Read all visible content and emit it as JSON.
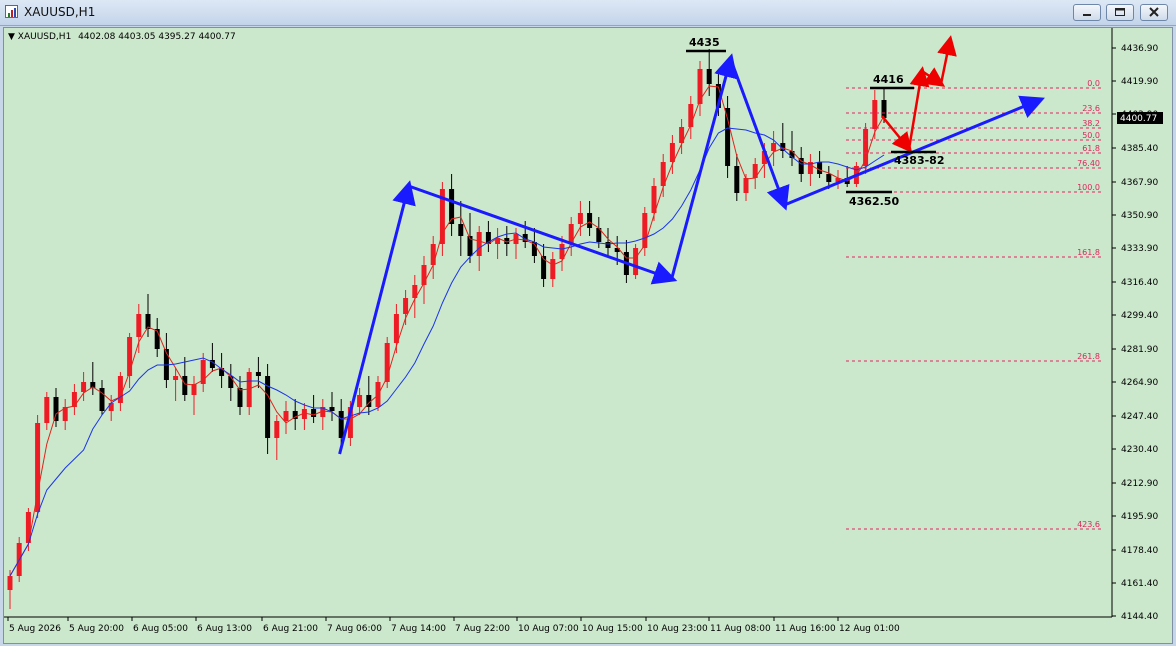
{
  "window": {
    "title": "XAUUSD,H1",
    "icon": "chart-window-icon"
  },
  "controls": {
    "minimize_icon": "minimize-icon",
    "restore_icon": "restore-icon",
    "close_icon": "close-icon"
  },
  "info": {
    "symbol": "XAUUSD,H1",
    "open": "4402.08",
    "high": "4403.05",
    "low": "4395.27",
    "close": "4400.77"
  },
  "colors": {
    "background": "#cce8cc",
    "bull": "#ee1b24",
    "bear": "#000000",
    "ma_fast": "#e0241b",
    "ma_slow": "#1a35e8",
    "pattern_blue": "#1a1aff",
    "projection_red": "#ee0000",
    "fib": "#e0245c",
    "price_marker_bg": "#000000"
  },
  "chart_data": {
    "type": "candlestick",
    "symbol": "XAUUSD",
    "timeframe": "H1",
    "ylim": [
      4144.0,
      4445.0
    ],
    "y_ticks": [
      "4436.90",
      "4419.90",
      "4402.90",
      "4385.40",
      "4367.90",
      "4350.90",
      "4333.90",
      "4316.40",
      "4299.40",
      "4281.90",
      "4264.90",
      "4247.40",
      "4230.40",
      "4212.90",
      "4195.90",
      "4178.40",
      "4161.40",
      "4144.40"
    ],
    "current_price": "4400.77",
    "x_ticks": [
      "5 Aug 2026",
      "5 Aug 20:00",
      "6 Aug 05:00",
      "6 Aug 13:00",
      "6 Aug 21:00",
      "7 Aug 06:00",
      "7 Aug 14:00",
      "7 Aug 22:00",
      "10 Aug 07:00",
      "10 Aug 15:00",
      "10 Aug 23:00",
      "11 Aug 08:00",
      "11 Aug 16:00",
      "12 Aug 01:00"
    ],
    "candles": [
      [
        4158,
        4168,
        4148,
        4165
      ],
      [
        4165,
        4185,
        4162,
        4182
      ],
      [
        4182,
        4200,
        4178,
        4198
      ],
      [
        4198,
        4248,
        4195,
        4244
      ],
      [
        4244,
        4260,
        4240,
        4257
      ],
      [
        4257,
        4262,
        4242,
        4245
      ],
      [
        4245,
        4256,
        4240,
        4252
      ],
      [
        4252,
        4264,
        4248,
        4260
      ],
      [
        4260,
        4270,
        4255,
        4265
      ],
      [
        4265,
        4275,
        4258,
        4262
      ],
      [
        4262,
        4266,
        4248,
        4250
      ],
      [
        4250,
        4258,
        4245,
        4254
      ],
      [
        4254,
        4270,
        4250,
        4268
      ],
      [
        4268,
        4290,
        4262,
        4288
      ],
      [
        4288,
        4305,
        4280,
        4300
      ],
      [
        4300,
        4310,
        4288,
        4292
      ],
      [
        4292,
        4298,
        4278,
        4282
      ],
      [
        4282,
        4290,
        4262,
        4266
      ],
      [
        4266,
        4272,
        4255,
        4268
      ],
      [
        4268,
        4278,
        4255,
        4258
      ],
      [
        4258,
        4268,
        4248,
        4264
      ],
      [
        4264,
        4280,
        4260,
        4276
      ],
      [
        4276,
        4285,
        4270,
        4272
      ],
      [
        4272,
        4280,
        4262,
        4268
      ],
      [
        4268,
        4274,
        4255,
        4262
      ],
      [
        4262,
        4268,
        4248,
        4252
      ],
      [
        4252,
        4272,
        4248,
        4270
      ],
      [
        4270,
        4278,
        4262,
        4268
      ],
      [
        4268,
        4274,
        4228,
        4236
      ],
      [
        4236,
        4248,
        4225,
        4245
      ],
      [
        4245,
        4255,
        4238,
        4250
      ],
      [
        4250,
        4256,
        4240,
        4246
      ],
      [
        4246,
        4254,
        4240,
        4251
      ],
      [
        4251,
        4258,
        4244,
        4247
      ],
      [
        4247,
        4256,
        4240,
        4252
      ],
      [
        4252,
        4260,
        4245,
        4250
      ],
      [
        4250,
        4256,
        4230,
        4236
      ],
      [
        4236,
        4255,
        4232,
        4252
      ],
      [
        4252,
        4262,
        4248,
        4258
      ],
      [
        4258,
        4268,
        4248,
        4252
      ],
      [
        4252,
        4268,
        4250,
        4265
      ],
      [
        4265,
        4288,
        4262,
        4285
      ],
      [
        4285,
        4305,
        4280,
        4300
      ],
      [
        4300,
        4312,
        4294,
        4308
      ],
      [
        4308,
        4320,
        4298,
        4315
      ],
      [
        4315,
        4330,
        4305,
        4325
      ],
      [
        4325,
        4340,
        4318,
        4336
      ],
      [
        4336,
        4368,
        4330,
        4364
      ],
      [
        4364,
        4372,
        4340,
        4346
      ],
      [
        4346,
        4358,
        4330,
        4340
      ],
      [
        4340,
        4352,
        4326,
        4330
      ],
      [
        4330,
        4345,
        4322,
        4342
      ],
      [
        4342,
        4348,
        4332,
        4336
      ],
      [
        4336,
        4344,
        4328,
        4339
      ],
      [
        4339,
        4345,
        4330,
        4336
      ],
      [
        4336,
        4344,
        4328,
        4341
      ],
      [
        4341,
        4348,
        4334,
        4337
      ],
      [
        4337,
        4344,
        4326,
        4330
      ],
      [
        4330,
        4336,
        4314,
        4318
      ],
      [
        4318,
        4332,
        4314,
        4328
      ],
      [
        4328,
        4340,
        4322,
        4336
      ],
      [
        4336,
        4350,
        4330,
        4346
      ],
      [
        4346,
        4358,
        4340,
        4352
      ],
      [
        4352,
        4358,
        4340,
        4344
      ],
      [
        4344,
        4350,
        4334,
        4337
      ],
      [
        4337,
        4344,
        4330,
        4334
      ],
      [
        4334,
        4340,
        4325,
        4332
      ],
      [
        4332,
        4338,
        4316,
        4320
      ],
      [
        4320,
        4336,
        4318,
        4334
      ],
      [
        4334,
        4355,
        4330,
        4352
      ],
      [
        4352,
        4370,
        4348,
        4366
      ],
      [
        4366,
        4382,
        4360,
        4378
      ],
      [
        4378,
        4392,
        4372,
        4388
      ],
      [
        4388,
        4400,
        4382,
        4396
      ],
      [
        4396,
        4412,
        4390,
        4408
      ],
      [
        4408,
        4430,
        4402,
        4426
      ],
      [
        4426,
        4436,
        4412,
        4418
      ],
      [
        4418,
        4424,
        4402,
        4406
      ],
      [
        4406,
        4412,
        4370,
        4376
      ],
      [
        4376,
        4382,
        4358,
        4362
      ],
      [
        4362,
        4372,
        4358,
        4370
      ],
      [
        4370,
        4380,
        4364,
        4377
      ],
      [
        4377,
        4388,
        4370,
        4384
      ],
      [
        4384,
        4394,
        4376,
        4388
      ],
      [
        4388,
        4398,
        4380,
        4384
      ],
      [
        4384,
        4394,
        4376,
        4380
      ],
      [
        4380,
        4386,
        4368,
        4372
      ],
      [
        4372,
        4382,
        4366,
        4378
      ],
      [
        4378,
        4384,
        4370,
        4372
      ],
      [
        4372,
        4376,
        4364,
        4368
      ],
      [
        4368,
        4374,
        4364,
        4370
      ],
      [
        4370,
        4376,
        4365,
        4367
      ],
      [
        4367,
        4378,
        4365,
        4376
      ],
      [
        4376,
        4398,
        4372,
        4395
      ],
      [
        4395,
        4415,
        4390,
        4410
      ],
      [
        4410,
        4416,
        4398,
        4401
      ]
    ],
    "fib_levels": [
      {
        "label": "0.0",
        "price": 4416.0
      },
      {
        "label": "23.6",
        "price": 4403.3
      },
      {
        "label": "38.2",
        "price": 4395.5
      },
      {
        "label": "50.0",
        "price": 4389.2
      },
      {
        "label": "61.8",
        "price": 4382.9
      },
      {
        "label": "76.40",
        "price": 4375.1
      },
      {
        "label": "100.0",
        "price": 4362.5
      },
      {
        "label": "161.8",
        "price": 4329.4
      },
      {
        "label": "261.8",
        "price": 4275.9
      },
      {
        "label": "423.6",
        "price": 4189.2
      }
    ],
    "annotations": [
      {
        "text": "4435",
        "price": 4435
      },
      {
        "text": "4416",
        "price": 4416
      },
      {
        "text": "4383-82",
        "price": 4383
      },
      {
        "text": "4362.50",
        "price": 4362.5
      }
    ]
  }
}
